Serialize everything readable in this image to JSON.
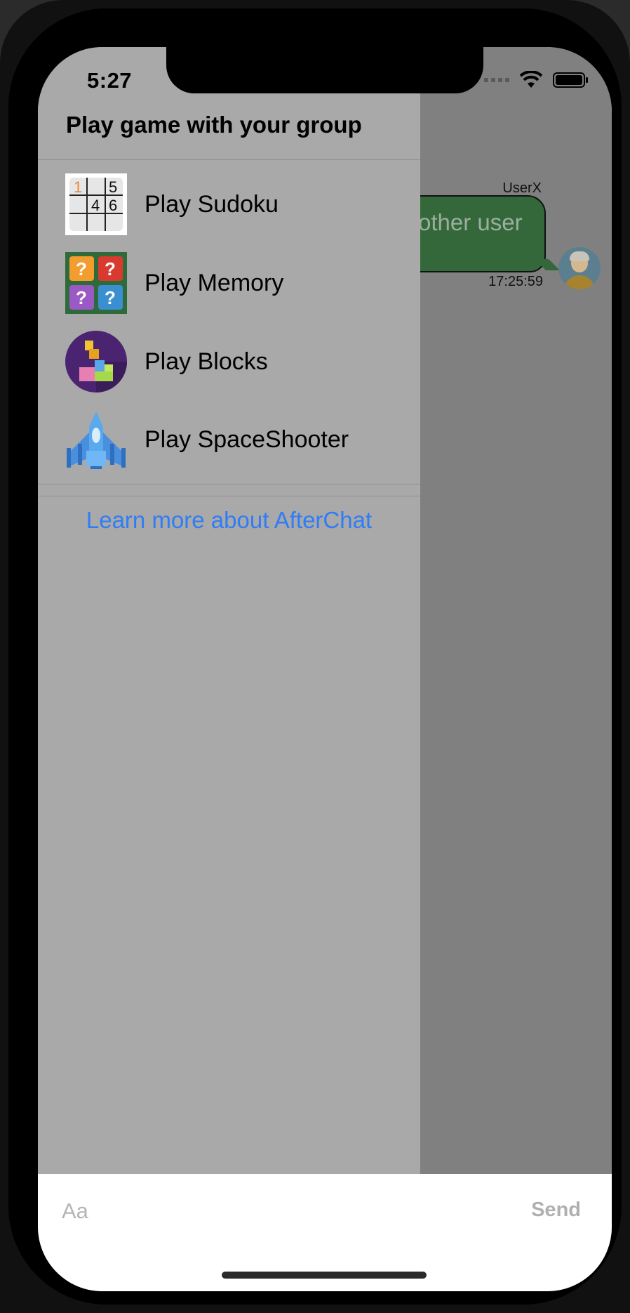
{
  "status_bar": {
    "time": "5:27"
  },
  "chat": {
    "sender": "UserX",
    "message_partial": "other user",
    "timestamp": "17:25:59"
  },
  "drawer": {
    "title": "Play game with your group",
    "games": [
      {
        "label": "Play Sudoku",
        "icon": "sudoku-icon"
      },
      {
        "label": "Play Memory",
        "icon": "memory-icon"
      },
      {
        "label": "Play Blocks",
        "icon": "blocks-icon"
      },
      {
        "label": "Play SpaceShooter",
        "icon": "spaceshooter-icon"
      }
    ],
    "learn_more": "Learn more about AfterChat"
  },
  "composer": {
    "placeholder": "Aa",
    "send_label": "Send"
  },
  "sudoku_icon_digits": [
    "1",
    "5",
    "4",
    "6"
  ],
  "colors": {
    "drawer_bg": "#a9a9a9",
    "link": "#2f7df6",
    "bubble": "#34683a"
  }
}
